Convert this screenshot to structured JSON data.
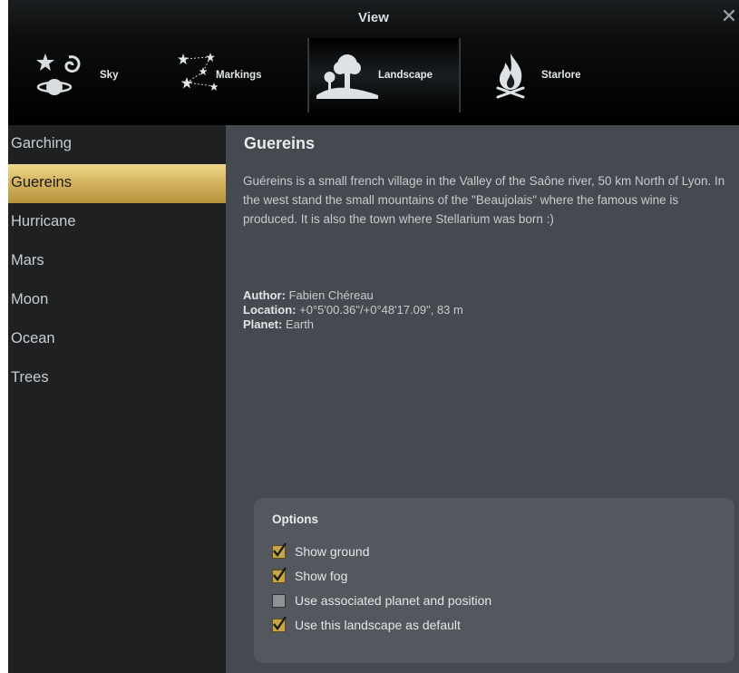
{
  "window": {
    "title": "View"
  },
  "tabs": [
    {
      "label": "Sky",
      "icon": "sky-icon"
    },
    {
      "label": "Markings",
      "icon": "markings-icon"
    },
    {
      "label": "Landscape",
      "icon": "landscape-icon"
    },
    {
      "label": "Starlore",
      "icon": "starlore-icon"
    }
  ],
  "landscapes": [
    "Garching",
    "Guereins",
    "Hurricane",
    "Mars",
    "Moon",
    "Ocean",
    "Trees"
  ],
  "selected_landscape": "Guereins",
  "detail": {
    "title": "Guereins",
    "description": "Guéreins is a small french village in the Valley of the Saône river, 50 km North of Lyon. In the west stand the small mountains of the \"Beaujolais\" where the famous wine is produced. It is also the town where Stellarium was born :)",
    "author_label": "Author:",
    "author": "Fabien Chéreau",
    "location_label": "Location:",
    "location": "+0°5'00.36\"/+0°48'17.09\", 83 m",
    "planet_label": "Planet:",
    "planet": "Earth"
  },
  "options": {
    "title": "Options",
    "show_ground": {
      "label": "Show ground",
      "checked": true
    },
    "show_fog": {
      "label": "Show fog",
      "checked": true
    },
    "use_planet": {
      "label": "Use associated planet and position",
      "checked": false
    },
    "use_default": {
      "label": "Use this landscape as default",
      "checked": true
    }
  },
  "colors": {
    "accent": "#d5b560",
    "background": "#444a4f",
    "sidebar": "#1e2022",
    "titlebar": "#000000"
  }
}
